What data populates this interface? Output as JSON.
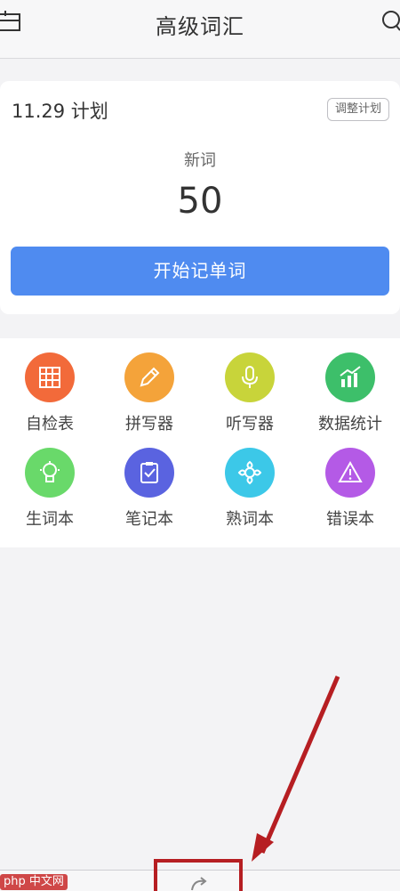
{
  "header": {
    "title": "高级词汇",
    "left_icon": "calendar-icon",
    "right_icon": "search-icon"
  },
  "plan": {
    "date_label": "11.29 计划",
    "adjust_button": "调整计划",
    "new_words_label": "新词",
    "new_words_count": "50",
    "start_button": "开始记单词"
  },
  "tools": [
    {
      "label": "自检表",
      "icon": "grid-table-icon",
      "color": "#f26a3a"
    },
    {
      "label": "拼写器",
      "icon": "pencil-icon",
      "color": "#f4a33a"
    },
    {
      "label": "听写器",
      "icon": "microphone-icon",
      "color": "#c8d43a"
    },
    {
      "label": "数据统计",
      "icon": "bar-chart-icon",
      "color": "#3dbf6a"
    },
    {
      "label": "生词本",
      "icon": "lightbulb-icon",
      "color": "#69d96a"
    },
    {
      "label": "笔记本",
      "icon": "note-check-icon",
      "color": "#5a63e0"
    },
    {
      "label": "熟词本",
      "icon": "flower-icon",
      "color": "#3cc8e8"
    },
    {
      "label": "错误本",
      "icon": "warning-icon",
      "color": "#b45ae6"
    }
  ],
  "bottom_nav": {
    "highlighted_tab_icon": "refresh-icon"
  },
  "watermark": "php 中文网",
  "colors": {
    "accent": "#4f8bf0",
    "annotation": "#b61e22"
  }
}
